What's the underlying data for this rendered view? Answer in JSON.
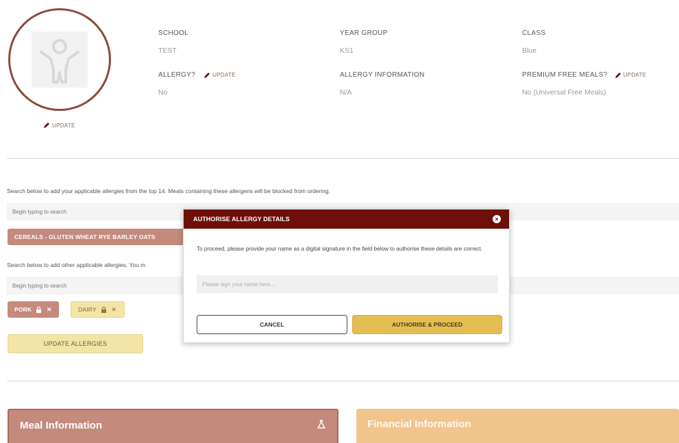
{
  "profile": {
    "update_label": "UPDATE"
  },
  "info": {
    "school": {
      "label": "SCHOOL",
      "value": "TEST"
    },
    "year_group": {
      "label": "YEAR GROUP",
      "value": "KS1"
    },
    "class": {
      "label": "CLASS",
      "value": "Blue"
    },
    "allergy": {
      "label": "ALLERGY?",
      "update_label": "UPDATE",
      "value": "No"
    },
    "allergy_information": {
      "label": "ALLERGY INFORMATION",
      "value": "N/A"
    },
    "premium_free_meals": {
      "label": "PREMIUM FREE MEALS?",
      "update_label": "UPDATE",
      "value": "No (Universal Free Meals)"
    }
  },
  "allergens": {
    "top14_helper": "Search below to add your applicable allergies from the top 14. Meals containing these allergens will be blocked from ordering.",
    "top14_placeholder": "Begin typing to search",
    "top14_tags": [
      "CEREALS - GLUTEN WHEAT RYE BARLEY OATS"
    ],
    "other_helper": "Search below to add other applicable allergies. You m",
    "other_placeholder": "Begin typing to search",
    "other_tags": [
      {
        "label": "PORK",
        "style": "brown"
      },
      {
        "label": "DAIRY",
        "style": "yellow"
      }
    ],
    "update_button": "UPDATE ALLERGIES"
  },
  "cards": {
    "meal_title": "Meal Information",
    "financial_title": "Financial Information"
  },
  "modal": {
    "title": "AUTHORISE ALLERGY DETAILS",
    "close": "×",
    "message": "To proceed, please provide your name as a digital signature in the field below to authorise these details are correct.",
    "signature_placeholder": "Please sign your name here...",
    "cancel_label": "CANCEL",
    "proceed_label": "AUTHORISE & PROCEED"
  },
  "colors": {
    "brand_dark": "#6e0f0a",
    "brown": "#c48a7c",
    "gold": "#e5be52",
    "cream": "#f4e4a6",
    "peach": "#f2c48e"
  },
  "icons": [
    "child-icon",
    "pencil-icon",
    "lock-icon",
    "remove-icon",
    "close-icon",
    "flask-icon"
  ]
}
